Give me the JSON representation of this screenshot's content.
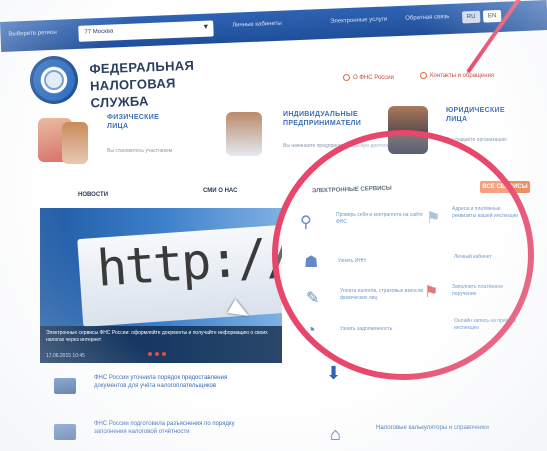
{
  "topbar": {
    "left_label": "Выберите регион",
    "region_value": "77 Москва",
    "items": [
      "Личные кабинеты",
      "Электронные услуги",
      "Обратная связь"
    ],
    "lang_items": [
      "RU",
      "EN"
    ]
  },
  "header": {
    "title_line1": "ФЕДЕРАЛЬНАЯ",
    "title_line2": "НАЛОГОВАЯ СЛУЖБА",
    "links": [
      "О ФНС России",
      "Контакты и обращения"
    ]
  },
  "categories": [
    {
      "title_line1": "ФИЗИЧЕСКИЕ",
      "title_line2": "ЛИЦА",
      "subtitle": "Вы становитесь участником"
    },
    {
      "title_line1": "ИНДИВИДУАЛЬНЫЕ",
      "title_line2": "ПРЕДПРИНИМАТЕЛИ",
      "subtitle": "Вы начинаете предпринимательскую деятельность"
    },
    {
      "title_line1": "ЮРИДИЧЕСКИЕ",
      "title_line2": "ЛИЦА",
      "subtitle": "Вы создаёте организацию"
    }
  ],
  "tabs": [
    "НОВОСТИ",
    "СМИ О НАС"
  ],
  "banner": {
    "url_text": "http://www",
    "caption": "Электронные сервисы ФНС России: оформляйте документы и получайте информацию о своих налогах через интернет",
    "date": "17.06.2015 10:45"
  },
  "news": [
    {
      "text": "ФНС России уточнила порядок предоставления документов для учёта налогоплательщиков"
    },
    {
      "text": "ФНС России подготовила разъяснения по порядку заполнения налоговой отчётности"
    }
  ],
  "services": {
    "title": "ЭЛЕКТРОННЫЕ СЕРВИСЫ",
    "all_button": "ВСЕ СЕРВИСЫ",
    "rows": [
      {
        "icon": "search-icon",
        "left": "Проверь себя и контрагента на сайте ФНС",
        "right": "Адреса и платёжные реквизиты вашей инспекции"
      },
      {
        "icon": "user-icon",
        "left": "Узнать ИНН",
        "right": "Личный кабинет"
      },
      {
        "icon": "pen-icon",
        "left": "Уплата налогов, страховых взносов физических лиц",
        "right": "Заполнить платёжное поручение"
      },
      {
        "icon": "clock-icon",
        "left": "Узнать задолженность",
        "right": "Онлайн запись на приём в инспекцию"
      }
    ]
  },
  "bottom_service": {
    "text": "Налоговые калькуляторы и справочники"
  }
}
